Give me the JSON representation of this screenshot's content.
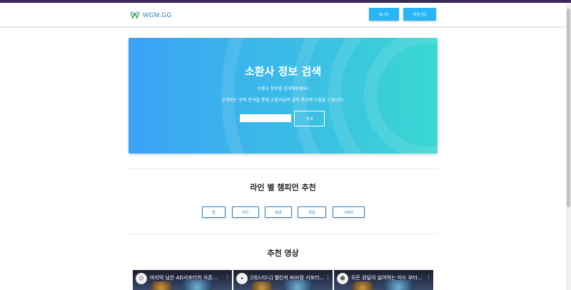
{
  "navbar": {
    "logo_text": "WGM.GG",
    "login_label": "로그인",
    "signup_label": "회원가입"
  },
  "hero": {
    "title": "소환사 정보 검색",
    "subtitle1": "소환사 정보를 검색해보세요!",
    "subtitle2": "우정머는 전적 분석을 통해 소환사님의 실력 향상에 도움을 드립니다.",
    "search_value": "",
    "search_button": "검색"
  },
  "lanes": {
    "title": "라인 별 챔피언 추천",
    "buttons": [
      "탑",
      "미드",
      "정글",
      "원딜",
      "서포터"
    ]
  },
  "videos": {
    "title": "추천 영상",
    "items": [
      {
        "title": "마지막 남은 AD서포터의 자존...",
        "avatar": "☺"
      },
      {
        "title": "[데스티니] 챌린저 800점 서포터...",
        "avatar": "✦"
      },
      {
        "title": "모든 원딜이 싫어하는 미드 부터...",
        "avatar": "☻"
      }
    ]
  },
  "colors": {
    "accent": "#29b6f6",
    "hero_start": "#3aa3f5",
    "hero_end": "#3ad8d2",
    "lane_border": "#2f7fc6"
  }
}
